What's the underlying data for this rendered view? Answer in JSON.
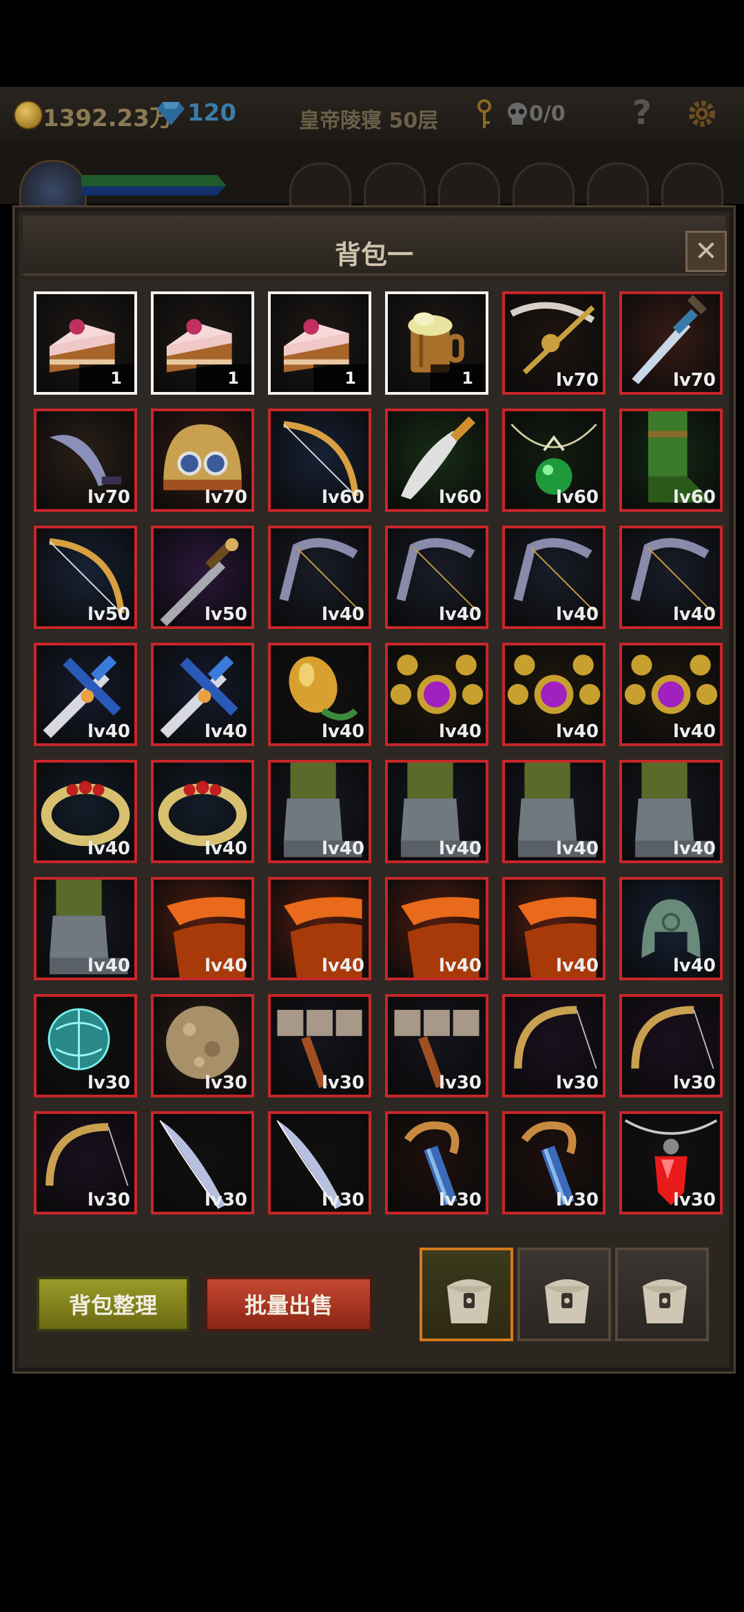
{
  "top_bar": {
    "gold_amount": "1392.23万",
    "gem_amount": "120",
    "floor_label": "皇帝陵寝 50层",
    "key_count": "0/0",
    "help_label": "?"
  },
  "panel": {
    "title": "背包一",
    "close_label": "✕"
  },
  "inventory": [
    {
      "item": "cake",
      "label": "1",
      "rarity": "white"
    },
    {
      "item": "cake",
      "label": "1",
      "rarity": "white"
    },
    {
      "item": "cake",
      "label": "1",
      "rarity": "white"
    },
    {
      "item": "beer-mug",
      "label": "1",
      "rarity": "white"
    },
    {
      "item": "crossbow",
      "label": "lv70",
      "rarity": "red"
    },
    {
      "item": "dagger",
      "label": "lv70",
      "rarity": "red"
    },
    {
      "item": "curved-dagger",
      "label": "lv70",
      "rarity": "red"
    },
    {
      "item": "goggle-helmet",
      "label": "lv70",
      "rarity": "red"
    },
    {
      "item": "bow",
      "label": "lv60",
      "rarity": "red"
    },
    {
      "item": "curved-knife",
      "label": "lv60",
      "rarity": "red"
    },
    {
      "item": "green-amulet",
      "label": "lv60",
      "rarity": "red"
    },
    {
      "item": "green-boots",
      "label": "lv60",
      "rarity": "red"
    },
    {
      "item": "bow",
      "label": "lv50",
      "rarity": "red"
    },
    {
      "item": "purple-sword",
      "label": "lv50",
      "rarity": "red"
    },
    {
      "item": "dark-bow",
      "label": "lv40",
      "rarity": "red"
    },
    {
      "item": "dark-bow",
      "label": "lv40",
      "rarity": "red"
    },
    {
      "item": "dark-bow",
      "label": "lv40",
      "rarity": "red"
    },
    {
      "item": "dark-bow",
      "label": "lv40",
      "rarity": "red"
    },
    {
      "item": "blue-sword",
      "label": "lv40",
      "rarity": "red"
    },
    {
      "item": "blue-sword",
      "label": "lv40",
      "rarity": "red"
    },
    {
      "item": "golden-fruit",
      "label": "lv40",
      "rarity": "red"
    },
    {
      "item": "gold-necklace",
      "label": "lv40",
      "rarity": "red"
    },
    {
      "item": "gold-necklace",
      "label": "lv40",
      "rarity": "red"
    },
    {
      "item": "gold-necklace",
      "label": "lv40",
      "rarity": "red"
    },
    {
      "item": "ruby-ring",
      "label": "lv40",
      "rarity": "red"
    },
    {
      "item": "ruby-ring",
      "label": "lv40",
      "rarity": "red"
    },
    {
      "item": "armored-boots",
      "label": "lv40",
      "rarity": "red"
    },
    {
      "item": "armored-boots",
      "label": "lv40",
      "rarity": "red"
    },
    {
      "item": "armored-boots",
      "label": "lv40",
      "rarity": "red"
    },
    {
      "item": "armored-boots",
      "label": "lv40",
      "rarity": "red"
    },
    {
      "item": "armored-boots",
      "label": "lv40",
      "rarity": "red"
    },
    {
      "item": "orange-cloak",
      "label": "lv40",
      "rarity": "red"
    },
    {
      "item": "orange-cloak",
      "label": "lv40",
      "rarity": "red"
    },
    {
      "item": "orange-cloak",
      "label": "lv40",
      "rarity": "red"
    },
    {
      "item": "orange-cloak",
      "label": "lv40",
      "rarity": "red"
    },
    {
      "item": "green-helmet",
      "label": "lv40",
      "rarity": "red"
    },
    {
      "item": "teal-orb",
      "label": "lv30",
      "rarity": "red"
    },
    {
      "item": "stone-ball",
      "label": "lv30",
      "rarity": "red"
    },
    {
      "item": "war-hammer",
      "label": "lv30",
      "rarity": "red"
    },
    {
      "item": "war-hammer",
      "label": "lv30",
      "rarity": "red"
    },
    {
      "item": "gold-bow",
      "label": "lv30",
      "rarity": "red"
    },
    {
      "item": "gold-bow",
      "label": "lv30",
      "rarity": "red"
    },
    {
      "item": "gold-bow",
      "label": "lv30",
      "rarity": "red"
    },
    {
      "item": "scimitar",
      "label": "lv30",
      "rarity": "red"
    },
    {
      "item": "scimitar",
      "label": "lv30",
      "rarity": "red"
    },
    {
      "item": "horn-staff",
      "label": "lv30",
      "rarity": "red"
    },
    {
      "item": "horn-staff",
      "label": "lv30",
      "rarity": "red"
    },
    {
      "item": "ruby-pendant",
      "label": "lv30",
      "rarity": "red"
    }
  ],
  "actions": {
    "sort_label": "背包整理",
    "sell_label": "批量出售"
  },
  "bag_tabs": [
    {
      "icon": "backpack-icon",
      "active": true
    },
    {
      "icon": "backpack-icon",
      "active": false
    },
    {
      "icon": "backpack-icon",
      "active": false
    }
  ],
  "colors": {
    "rarity_red": "#c8262a",
    "rarity_white": "#f2f2f2",
    "active_tab": "#d5791d"
  }
}
